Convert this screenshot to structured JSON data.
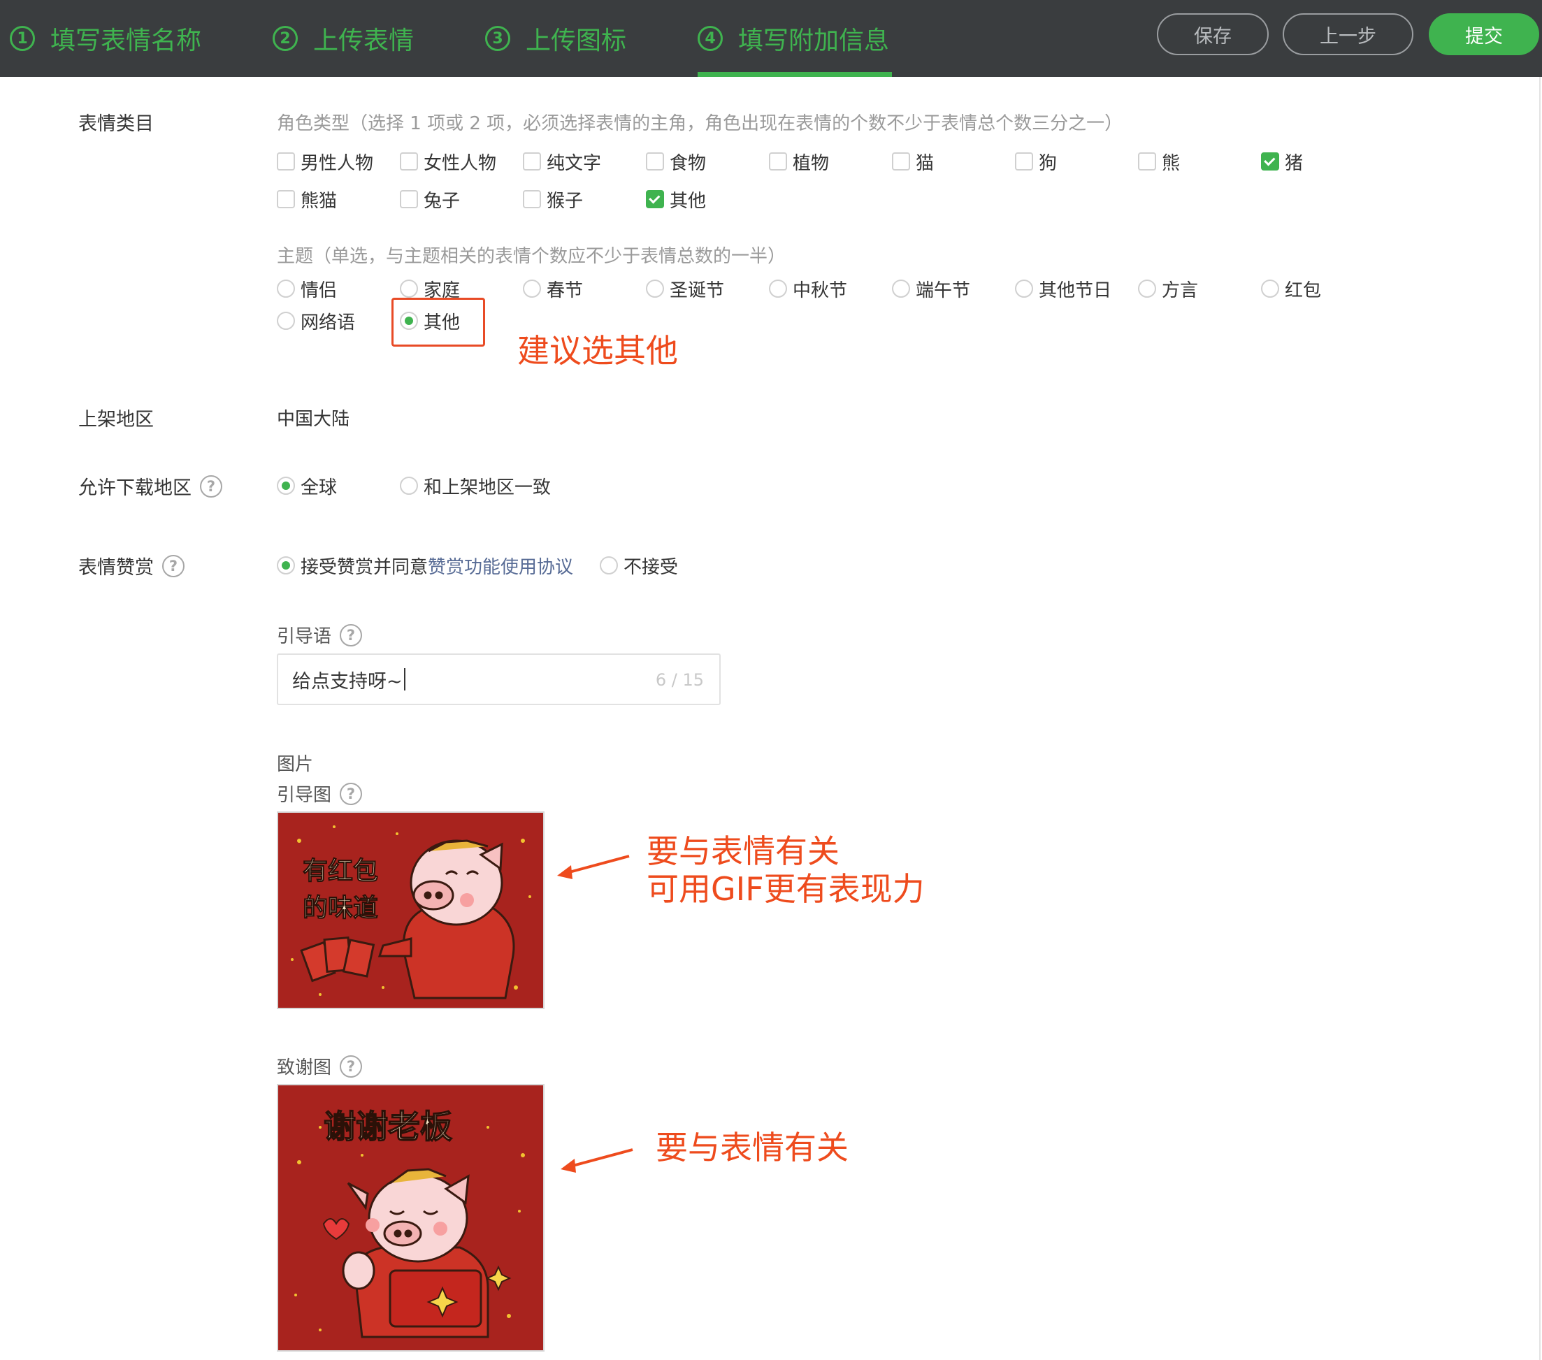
{
  "header": {
    "steps": [
      {
        "num": "1",
        "label": "填写表情名称"
      },
      {
        "num": "2",
        "label": "上传表情"
      },
      {
        "num": "3",
        "label": "上传图标"
      },
      {
        "num": "4",
        "label": "填写附加信息"
      }
    ],
    "save_label": "保存",
    "prev_label": "上一步",
    "submit_label": "提交",
    "accent_color": "#3fb34f"
  },
  "category": {
    "label": "表情类目",
    "role_hint": "角色类型（选择 1 项或 2 项，必须选择表情的主角，角色出现在表情的个数不少于表情总个数三分之一）",
    "roles": [
      {
        "label": "男性人物",
        "checked": false
      },
      {
        "label": "女性人物",
        "checked": false
      },
      {
        "label": "纯文字",
        "checked": false
      },
      {
        "label": "食物",
        "checked": false
      },
      {
        "label": "植物",
        "checked": false
      },
      {
        "label": "猫",
        "checked": false
      },
      {
        "label": "狗",
        "checked": false
      },
      {
        "label": "熊",
        "checked": false
      },
      {
        "label": "猪",
        "checked": true
      },
      {
        "label": "熊猫",
        "checked": false
      },
      {
        "label": "兔子",
        "checked": false
      },
      {
        "label": "猴子",
        "checked": false
      },
      {
        "label": "其他",
        "checked": true
      }
    ],
    "theme_hint": "主题（单选，与主题相关的表情个数应不少于表情总数的一半）",
    "themes": [
      {
        "label": "情侣",
        "checked": false
      },
      {
        "label": "家庭",
        "checked": false
      },
      {
        "label": "春节",
        "checked": false
      },
      {
        "label": "圣诞节",
        "checked": false
      },
      {
        "label": "中秋节",
        "checked": false
      },
      {
        "label": "端午节",
        "checked": false
      },
      {
        "label": "其他节日",
        "checked": false
      },
      {
        "label": "方言",
        "checked": false
      },
      {
        "label": "红包",
        "checked": false
      },
      {
        "label": "网络语",
        "checked": false
      },
      {
        "label": "其他",
        "checked": true
      }
    ]
  },
  "region": {
    "label": "上架地区",
    "value": "中国大陆"
  },
  "download": {
    "label": "允许下载地区",
    "options": [
      {
        "label": "全球",
        "checked": true
      },
      {
        "label": "和上架地区一致",
        "checked": false
      }
    ]
  },
  "reward": {
    "label": "表情赞赏",
    "accept_label": "接受赞赏并同意",
    "agreement_link": "赞赏功能使用协议",
    "reject_label": "不接受",
    "guide_text_label": "引导语",
    "guide_text_value": "给点支持呀~",
    "guide_text_counter": "6 / 15",
    "pictures_label": "图片",
    "guide_image_label": "引导图",
    "thanks_image_label": "致谢图",
    "guide_image_caption": [
      "有红包",
      "的味道"
    ],
    "thanks_image_caption": "谢谢老板"
  },
  "annotations": {
    "note_other": "建议选其他",
    "note_guide_1": "要与表情有关",
    "note_guide_2": "可用GIF更有表现力",
    "note_thanks": "要与表情有关",
    "color": "#ee4b1d"
  }
}
